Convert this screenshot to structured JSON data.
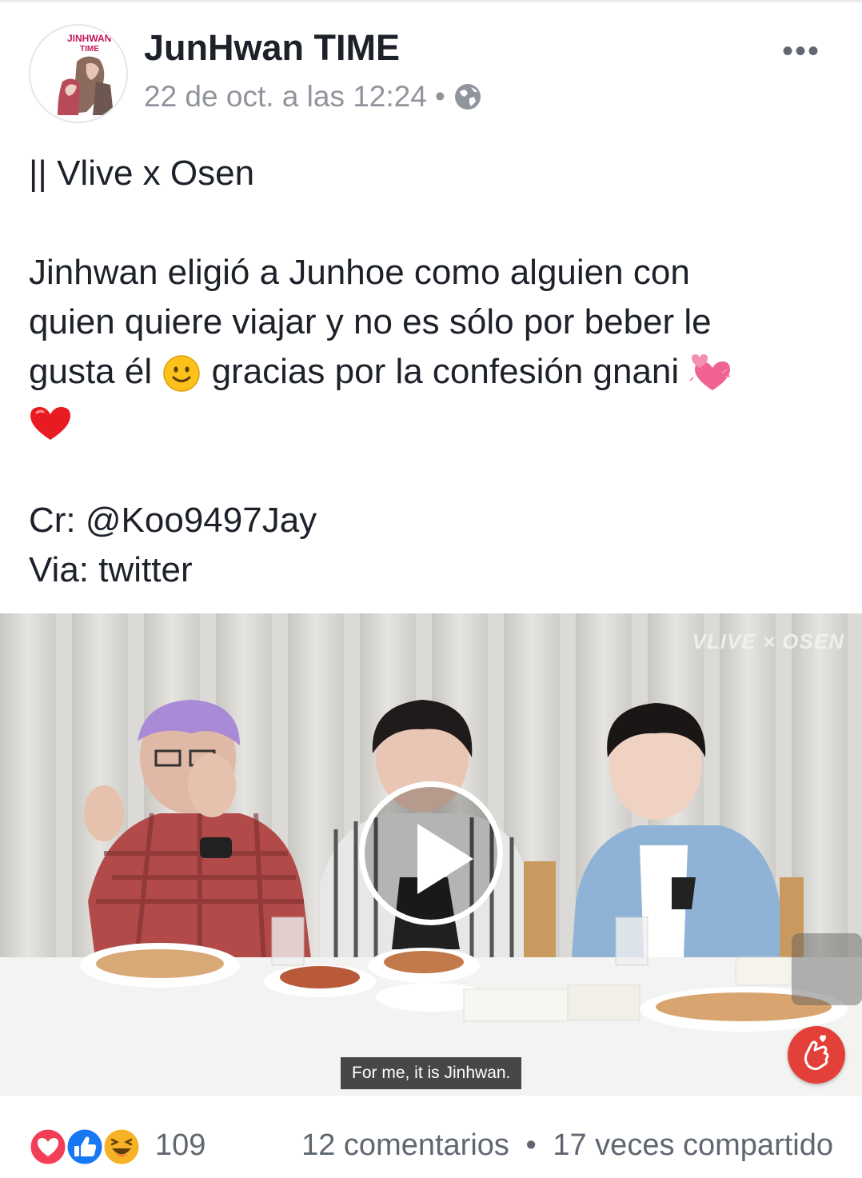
{
  "post": {
    "page_name": "JunHwan TIME",
    "avatar_text": "JINHWAN TIME",
    "timestamp": "22 de oct. a las 12:24",
    "separator": "•",
    "privacy_icon": "globe-icon",
    "more_icon": "•••",
    "text": {
      "title": "|| Vlive x Osen",
      "line1": "Jinhwan eligió a Junhoe como alguien con",
      "line2": "quien quiere viajar y no es sólo por beber le",
      "line3_a": "gusta él",
      "line3_b": "gracias por la confesión gnani",
      "credit": "Cr: @Koo9497Jay",
      "via": "Via: twitter"
    },
    "emojis": [
      "smiling-face-icon",
      "two-hearts-icon",
      "red-heart-icon"
    ]
  },
  "video": {
    "watermark": "VLIVE × OSEN",
    "subtitle": "For me, it is Jinhwan.",
    "play_icon": "play-icon",
    "heart_icon": "finger-heart-icon"
  },
  "footer": {
    "reaction_icons": [
      "love-reaction-icon",
      "like-reaction-icon",
      "haha-reaction-icon"
    ],
    "reaction_count": "109",
    "comments": "12 comentarios",
    "separator": "•",
    "shares": "17 veces compartido"
  },
  "colors": {
    "text": "#1d2129",
    "meta": "#90949c",
    "like": "#1877f2",
    "love": "#f33e58",
    "haha": "#f7b125",
    "accent_red": "#e4403a"
  }
}
